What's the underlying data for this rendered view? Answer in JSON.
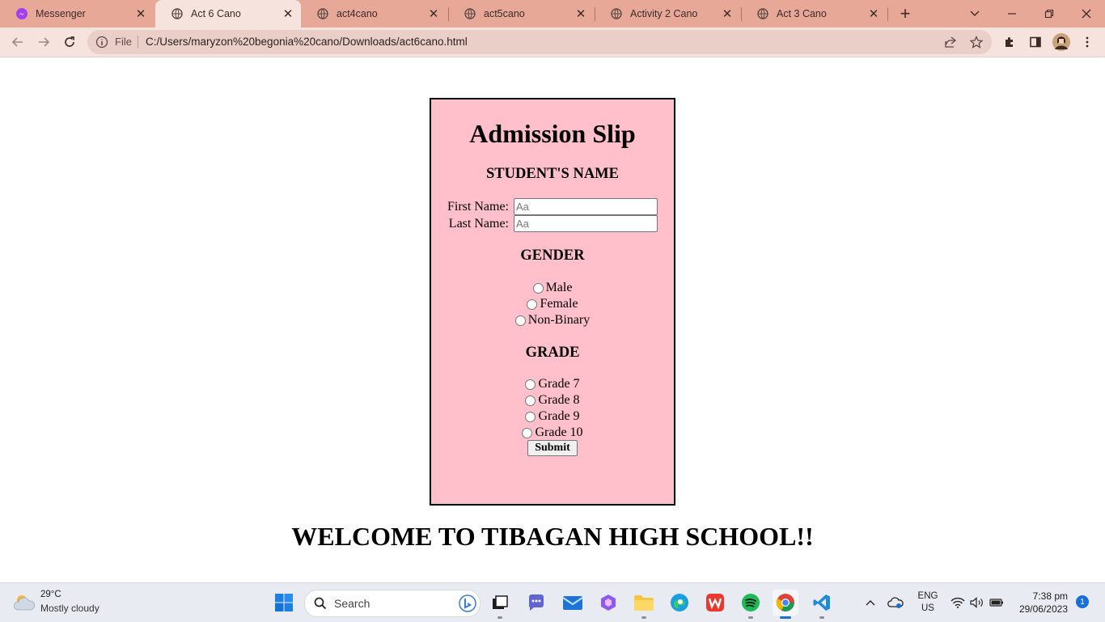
{
  "browser": {
    "tabs": [
      {
        "title": "Messenger",
        "icon": "messenger-icon",
        "active": false
      },
      {
        "title": "Act 6 Cano",
        "icon": "globe-icon",
        "active": true
      },
      {
        "title": "act4cano",
        "icon": "globe-icon",
        "active": false
      },
      {
        "title": "act5cano",
        "icon": "globe-icon",
        "active": false
      },
      {
        "title": "Activity 2 Cano",
        "icon": "globe-icon",
        "active": false
      },
      {
        "title": "Act 3 Cano",
        "icon": "globe-icon",
        "active": false
      }
    ],
    "address": {
      "scheme_label": "File",
      "url": "C:/Users/maryzon%20begonia%20cano/Downloads/act6cano.html"
    },
    "colors": {
      "tabstrip": "#e8a898",
      "toolbar": "#f6e3dd",
      "omnibox": "#e9cfc8"
    }
  },
  "page": {
    "slip": {
      "title": "Admission Slip",
      "name_heading": "STUDENT'S NAME",
      "first_name_label": "First Name:",
      "first_name_placeholder": "Aa",
      "first_name_value": "",
      "last_name_label": "Last Name:",
      "last_name_placeholder": "Aa",
      "last_name_value": "",
      "gender_heading": "GENDER",
      "gender_options": [
        "Male",
        "Female",
        "Non-Binary"
      ],
      "grade_heading": "GRADE",
      "grade_options": [
        "Grade 7",
        "Grade 8",
        "Grade 9",
        "Grade 10"
      ],
      "submit_label": "Submit",
      "background": "#ffc0cb"
    },
    "welcome": "WELCOME TO TIBAGAN HIGH SCHOOL!!"
  },
  "taskbar": {
    "weather": {
      "temp": "29°C",
      "desc": "Mostly cloudy"
    },
    "search_label": "Search",
    "apps": [
      "windows-start-icon",
      "file-explorer-icon",
      "teams-chat-icon",
      "mail-icon",
      "copilot-icon",
      "folder-icon",
      "edge-icon",
      "wps-office-icon",
      "spotify-icon",
      "chrome-icon",
      "vscode-icon"
    ],
    "lang_line1": "ENG",
    "lang_line2": "US",
    "time": "7:38 pm",
    "date": "29/06/2023",
    "notification_count": "1"
  }
}
